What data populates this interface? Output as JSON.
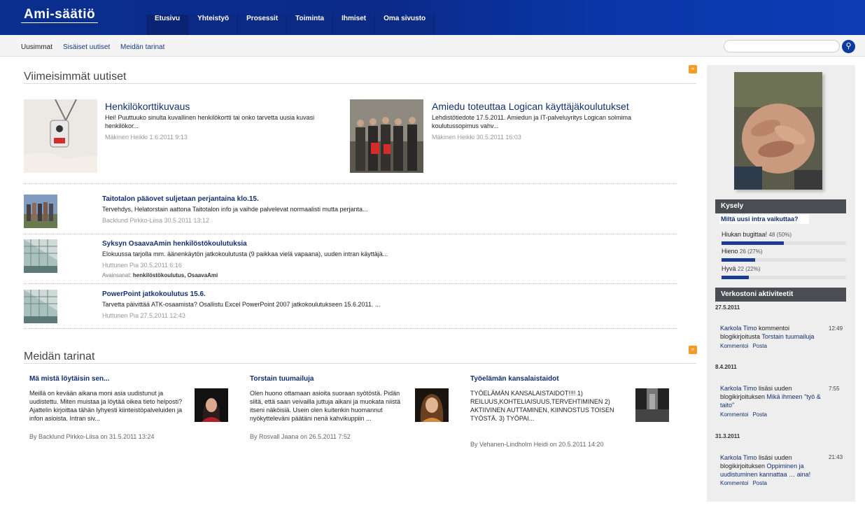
{
  "brand": {
    "logo": "Ami-säätiö"
  },
  "nav": {
    "tabs": [
      "Etusivu",
      "Yhteistyö",
      "Prosessit",
      "Toiminta",
      "Ihmiset",
      "Oma sivusto"
    ]
  },
  "subnav": {
    "items": [
      "Uusimmat",
      "Sisäiset uutiset",
      "Meidän tarinat"
    ]
  },
  "search": {
    "placeholder": ""
  },
  "news": {
    "title": "Viimeisimmät uutiset",
    "featured": [
      {
        "title": "Henkilökorttikuvaus",
        "text": "Hei!   Puuttuuko sinulta kuvallinen henkilökortti tai onko tarvetta uusia kuvasi henkilökor...",
        "meta": "Mäkinen Heikki 1.6.2011 9:13"
      },
      {
        "title": "Amiedu toteuttaa Logican käyttäjäkoulutukset",
        "text": "Lehdistötiedote 17.5.2011. Amiedun ja IT-palveluyritys Logican solmima koulutussopimus vahv...",
        "meta": "Mäkinen Heikki 30.5.2011 16:03"
      }
    ],
    "list": [
      {
        "title": "Taitotalon pääovet suljetaan perjantaina klo.15.",
        "text": "Tervehdys, Helatorstain aattona Taitotalon info ja vaihde palvelevat normaalisti mutta perjanta...",
        "meta": "Backlund Pirkko-Liisa 30.5.2011 13:12"
      },
      {
        "title": "Syksyn OsaavaAmin henkilöstökoulutuksia",
        "text": "Elokuussa tarjolla mm. äänenkäytön jatkokoulutusta (9 paikkaa vielä vapaana), uuden intran käyttäjä...",
        "meta": "Huttunen Pia 30.5.2011 6:16",
        "tags_label": "Avainsanat:",
        "tags": "henkilöstökoulutus, OsaavaAmi"
      },
      {
        "title": "PowerPoint jatkokoulutus 15.6.",
        "text": "Tarvetta päivittää ATK-osaamista? Osallistu  Excel PowerPoint 2007 jatkokoulutukseen 15.6.2011. ...",
        "meta": "Huttunen Pia 27.5.2011 12:43"
      }
    ]
  },
  "stories": {
    "title": "Meidän tarinat",
    "items": [
      {
        "title": "Mä mistä löytäisin sen...",
        "text": "Meillä on kevään aikana moni asia uudistunut ja uudistettu. Miten muistaa ja löytää oikea tieto helposti? Ajattelin kirjoittaa tähän lyhyesti kiinteistöpalveluiden ja infon asioista.   Intran siv...",
        "meta": "By Backlund Pirkko-Liisa on 31.5.2011 13:24"
      },
      {
        "title": "Torstain tuumailuja",
        "text": "Olen huono ottamaan asioita suoraan syötöstä. Pidän siitä, että saan veivailla juttuja aikani ja muokata niistä itseni näköisiä. Usein olen kuitenkin huomannut nyökytteleväni päätäni nenä kahvikuppiin ...",
        "meta": "By Rosvall Jaana on 26.5.2011 7:52"
      },
      {
        "title": "Työelämän kansalaistaidot",
        "text": "TYÖELÄMÄN KANSALAISTAIDOT!!!!   1) REILUUS,KOHTELIAISUUS,TERVEHTIMINEN 2)              AKTIIVINEN AUTTAMINEN, KIINNOSTUS TOISEN                    TYÖSTÄ. 3)              TYÖPAI...",
        "meta": "By Vehanen-Lindholm Heidi on 20.5.2011 14:20"
      }
    ]
  },
  "poll": {
    "title": "Kysely",
    "question": "Miltä uusi intra vaikuttaa?",
    "options": [
      {
        "label": "Hiukan bugittaa!",
        "count": "48 (50%)",
        "fraction": 0.5
      },
      {
        "label": "Hieno",
        "count": "26 (27%)",
        "fraction": 0.27
      },
      {
        "label": "Hyvä",
        "count": "22 (22%)",
        "fraction": 0.22
      }
    ]
  },
  "activity": {
    "title": "Verkostoni aktiviteetit",
    "groups": [
      {
        "date": "27.5.2011",
        "actor": "Karkola Timo",
        "verb": " kommentoi blogikirjoitusta ",
        "target": "Torstain tuumailuja",
        "time": "12:49",
        "links": [
          "Kommentoi",
          "Posta"
        ]
      },
      {
        "date": "8.4.2011",
        "actor": "Karkola Timo",
        "verb": " lisäsi uuden blogikirjoituksen ",
        "target": "Mikä ihmeen \"työ & taito\"",
        "time": "7:55",
        "links": [
          "Kommentoi",
          "Posta"
        ]
      },
      {
        "date": "31.3.2011",
        "actor": "Karkola Timo",
        "verb": " lisäsi uuden blogikirjoituksen ",
        "target": "Oppiminen ja uudistuminen kannattaa … aina!",
        "time": "21:43",
        "links": [
          "Kommentoi",
          "Posta"
        ]
      }
    ]
  },
  "colors": {
    "brand_blue": "#0b2a8a",
    "link": "#12306f",
    "rss": "#f49a26"
  }
}
